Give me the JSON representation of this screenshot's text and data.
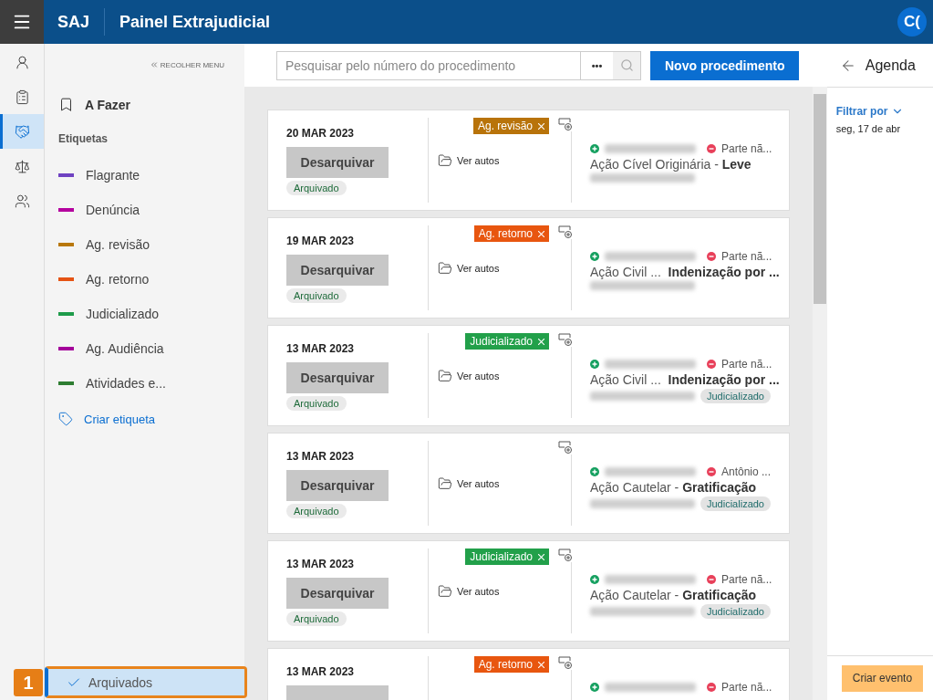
{
  "topbar": {
    "brand": "SAJ",
    "title": "Painel Extrajudicial",
    "avatar": "C("
  },
  "rail": [
    {
      "kind": "person-chat",
      "selected": false
    },
    {
      "kind": "clipboard",
      "selected": false
    },
    {
      "kind": "handshake",
      "selected": true
    },
    {
      "kind": "scales",
      "selected": false
    },
    {
      "kind": "people",
      "selected": false
    }
  ],
  "menu": {
    "collapse": "RECOLHER MENU",
    "todo": "A Fazer",
    "section": "Etiquetas",
    "tags": [
      {
        "label": "Flagrante",
        "color": "#6f42c1"
      },
      {
        "label": "Denúncia",
        "color": "#b4009e"
      },
      {
        "label": "Ag. revisão",
        "color": "#b8770b"
      },
      {
        "label": "Ag. retorno",
        "color": "#e55314"
      },
      {
        "label": "Judicializado",
        "color": "#1e9b4a"
      },
      {
        "label": "Ag. Audiência",
        "color": "#a4009a"
      },
      {
        "label": "Atividades e...",
        "color": "#2e7d32"
      }
    ],
    "create": "Criar etiqueta",
    "archived": {
      "label": "Arquivados",
      "selected": true
    },
    "callout": "1"
  },
  "toolbar": {
    "search": {
      "placeholder": "Pesquisar pelo número do procedimento"
    },
    "more": "•••",
    "new_button": "Novo procedimento"
  },
  "cards": [
    {
      "date": "20 MAR 2023",
      "button": "Desarquivar",
      "status": "Arquivado",
      "tag": {
        "label": "Ag. revisão",
        "color": "#b8730a"
      },
      "link": "Ver autos",
      "party_b": "Parte nã...",
      "title": "Ação Cível Originária - **Leve**"
    },
    {
      "date": "19 MAR 2023",
      "button": "Desarquivar",
      "status": "Arquivado",
      "tag": {
        "label": "Ag. retorno",
        "color": "#e8560f"
      },
      "link": "Ver autos",
      "party_b": "Parte nã...",
      "title": "Ação Civil ...  **Indenização por ...**"
    },
    {
      "date": "13 MAR 2023",
      "button": "Desarquivar",
      "status": "Arquivado",
      "tag": {
        "label": "Judicializado",
        "color": "#22a04a"
      },
      "link": "Ver autos",
      "party_b": "Parte nã...",
      "title": "Ação Civil ...  **Indenização por ...**",
      "chip": "Judicializado"
    },
    {
      "date": "13 MAR 2023",
      "button": "Desarquivar",
      "status": "Arquivado",
      "link": "Ver autos",
      "party_b": "Antônio ...",
      "title": "Ação Cautelar - **Gratificação**",
      "chip": "Judicializado"
    },
    {
      "date": "13 MAR 2023",
      "button": "Desarquivar",
      "status": "Arquivado",
      "tag": {
        "label": "Judicializado",
        "color": "#22a04a"
      },
      "link": "Ver autos",
      "party_b": "Parte nã...",
      "title": "Ação Cautelar - **Gratificação**",
      "chip": "Judicializado"
    },
    {
      "date": "13 MAR 2023",
      "tag": {
        "label": "Ag. retorno",
        "color": "#e8560f"
      },
      "party_b": "Parte nã..."
    }
  ],
  "agenda": {
    "title": "Agenda",
    "filter": "Filtrar por",
    "date": "seg, 17 de abr",
    "button": "Criar evento"
  }
}
